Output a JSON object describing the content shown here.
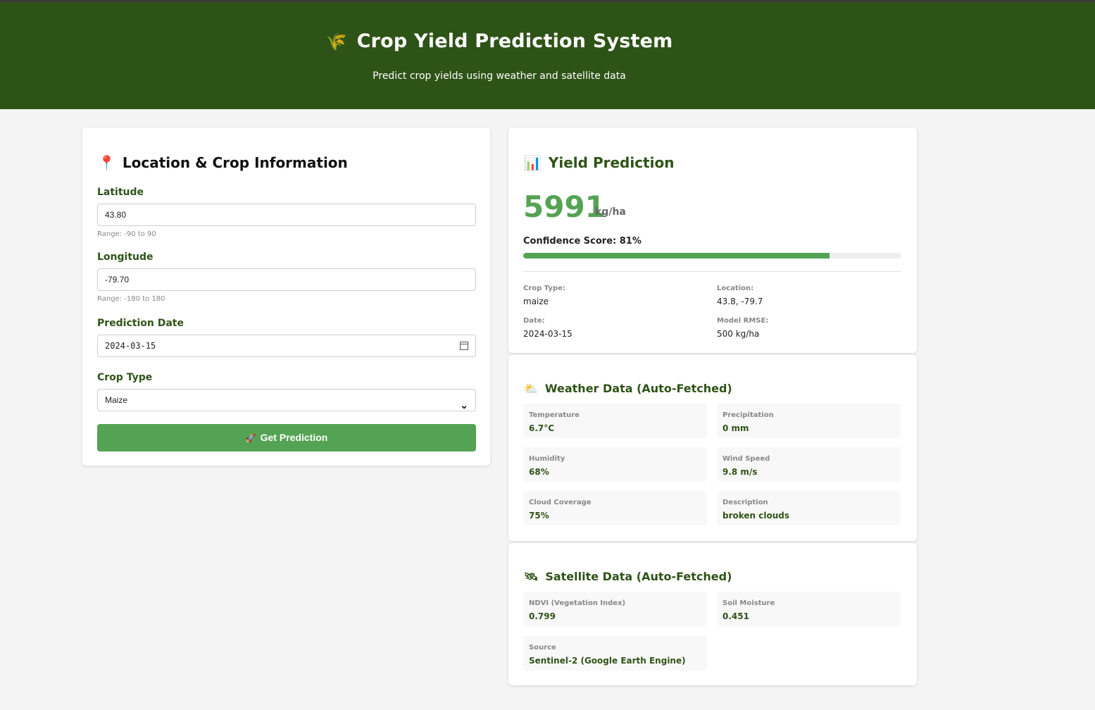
{
  "header": {
    "icon": "🌾",
    "title": "Crop Yield Prediction System",
    "subtitle": "Predict crop yields using weather and satellite data"
  },
  "form": {
    "icon": "📍",
    "title": "Location & Crop Information",
    "latitude": {
      "label": "Latitude",
      "value": "43.80",
      "hint": "Range: -90 to 90"
    },
    "longitude": {
      "label": "Longitude",
      "value": "-79.70",
      "hint": "Range: -180 to 180"
    },
    "date": {
      "label": "Prediction Date",
      "value": "2024-03-15"
    },
    "crop": {
      "label": "Crop Type",
      "value": "Maize"
    },
    "submit": {
      "icon": "🚀",
      "label": "Get Prediction"
    }
  },
  "prediction": {
    "icon": "📊",
    "title": "Yield Prediction",
    "value": "5991",
    "unit": "kg/ha",
    "confidence_label": "Confidence Score: 81%",
    "confidence_fraction": 0.81,
    "details": {
      "crop_label": "Crop Type:",
      "crop_value": "maize",
      "location_label": "Location:",
      "location_value": "43.8, -79.7",
      "date_label": "Date:",
      "date_value": "2024-03-15",
      "rmse_label": "Model RMSE:",
      "rmse_value": "500 kg/ha"
    }
  },
  "weather": {
    "icon": "⛅",
    "title": "Weather Data (Auto-Fetched)",
    "items": [
      {
        "label": "Temperature",
        "value": "6.7°C"
      },
      {
        "label": "Precipitation",
        "value": "0 mm"
      },
      {
        "label": "Humidity",
        "value": "68%"
      },
      {
        "label": "Wind Speed",
        "value": "9.8 m/s"
      },
      {
        "label": "Cloud Coverage",
        "value": "75%"
      },
      {
        "label": "Description",
        "value": "broken clouds"
      }
    ]
  },
  "satellite": {
    "icon": "🛰",
    "title": "Satellite Data (Auto-Fetched)",
    "items": [
      {
        "label": "NDVI (Vegetation Index)",
        "value": "0.799"
      },
      {
        "label": "Soil Moisture",
        "value": "0.451"
      },
      {
        "label": "Source",
        "value": "Sentinel-2 (Google Earth Engine)"
      }
    ]
  },
  "colors": {
    "header_bg": "#2e5317",
    "accent": "#54a354",
    "page_bg": "#f4f4f4"
  }
}
